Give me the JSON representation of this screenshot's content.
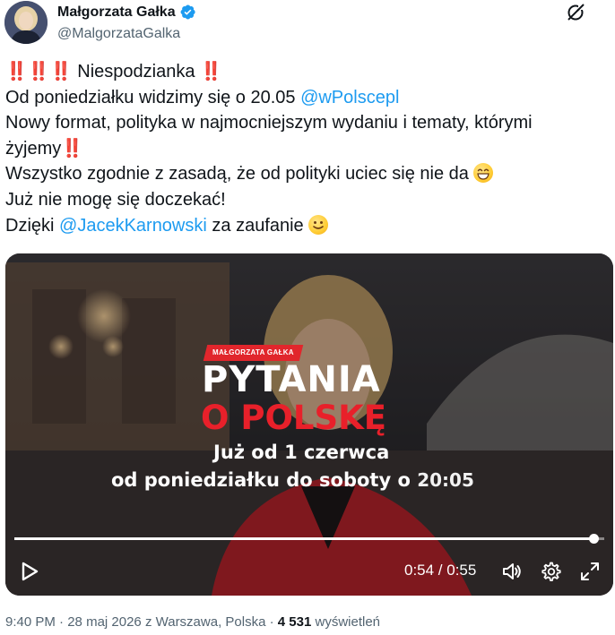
{
  "author": {
    "name": "Małgorzata Gałka",
    "handle": "@MalgorzataGalka",
    "verified": true,
    "avatar_icon": "avatar"
  },
  "tweet": {
    "lines": [
      {
        "parts": [
          {
            "t": "‼️‼️‼️",
            "k": "bang"
          },
          {
            "t": " Niespodzianka ",
            "k": "text"
          },
          {
            "t": "‼️",
            "k": "bang"
          }
        ]
      },
      {
        "parts": [
          {
            "t": "Od poniedziałku widzimy się o 20.05 ",
            "k": "text"
          },
          {
            "t": "@wPolscepl",
            "k": "mention"
          }
        ]
      },
      {
        "parts": [
          {
            "t": "Nowy format, polityka w najmocniejszym wydaniu i tematy, którymi",
            "k": "text"
          }
        ]
      },
      {
        "parts": [
          {
            "t": "żyjemy",
            "k": "text"
          },
          {
            "t": "‼️",
            "k": "bang"
          }
        ]
      },
      {
        "parts": [
          {
            "t": "Wszystko zgodnie z zasadą, że od polityki uciec się nie da ",
            "k": "text"
          },
          {
            "t": "grinning-emoji",
            "k": "emoji-grin"
          }
        ]
      },
      {
        "parts": [
          {
            "t": "Już nie mogę się doczekać!",
            "k": "text"
          }
        ]
      },
      {
        "parts": [
          {
            "t": "Dzięki ",
            "k": "text"
          },
          {
            "t": "@JacekKarnowski",
            "k": "mention"
          },
          {
            "t": " za zaufanie ",
            "k": "text"
          },
          {
            "t": "smiling-emoji",
            "k": "emoji-smile"
          }
        ]
      }
    ]
  },
  "video": {
    "badge": "MAŁGORZATA GAŁKA",
    "title_line1": "PYTANIA",
    "title_line2": "O POLSKĘ",
    "subtitle_line1": "Już od 1 czerwca",
    "subtitle_line2": "od poniedziałku do soboty o",
    "subtitle_time": "20:05",
    "time_readout": "0:54 / 0:55",
    "progress_fraction": 0.982,
    "colors": {
      "accent_red": "#e1262c",
      "mention_blue": "#1d9bf0"
    }
  },
  "meta": {
    "time": "9:40 PM",
    "date": "28 maj 2026",
    "location": "z Warszawa, Polska",
    "views_count": "4 531",
    "views_label": "wyświetleń"
  }
}
